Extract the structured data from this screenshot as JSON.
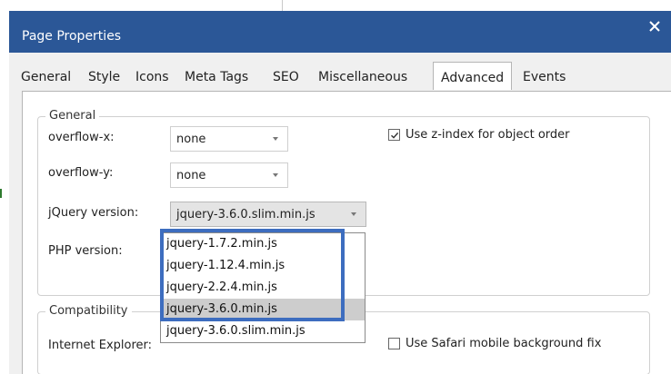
{
  "dialog": {
    "title": "Page Properties",
    "close_symbol": "×"
  },
  "tabs": [
    {
      "label": "General"
    },
    {
      "label": "Style"
    },
    {
      "label": "Icons"
    },
    {
      "label": "Meta Tags"
    },
    {
      "label": "SEO"
    },
    {
      "label": "Miscellaneous"
    },
    {
      "label": "Advanced",
      "active": true
    },
    {
      "label": "Events"
    }
  ],
  "general": {
    "legend": "General",
    "overflow_x": {
      "label": "overflow-x:",
      "value": "none"
    },
    "overflow_y": {
      "label": "overflow-y:",
      "value": "none"
    },
    "jquery": {
      "label": "jQuery version:",
      "value": "jquery-3.6.0.slim.min.js"
    },
    "php": {
      "label": "PHP version:"
    },
    "zindex_checkbox": {
      "label": "Use z-index for object order",
      "checked": true
    }
  },
  "compatibility": {
    "legend": "Compatibility",
    "ie": {
      "label": "Internet Explorer:"
    },
    "safari_checkbox": {
      "label": "Use Safari mobile background fix",
      "checked": false
    }
  },
  "jquery_dropdown": {
    "options": [
      "jquery-1.7.2.min.js",
      "jquery-1.12.4.min.js",
      "jquery-2.2.4.min.js",
      "jquery-3.6.0.min.js",
      "jquery-3.6.0.slim.min.js"
    ],
    "highlighted_option": "jquery-3.6.0.min.js"
  },
  "colors": {
    "titlebar": "#2b5797",
    "highlight_border": "#3d6dbf",
    "selected_option": "#cdcdcd"
  }
}
